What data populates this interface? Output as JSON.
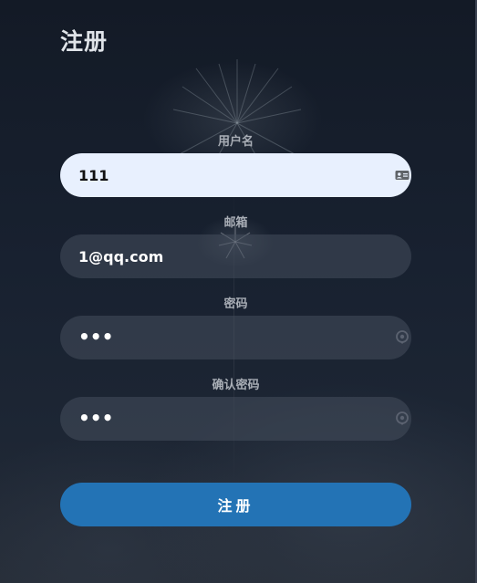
{
  "form": {
    "title": "注册",
    "fields": [
      {
        "label": "用户名",
        "value": "111",
        "icon": "contact-card-icon"
      },
      {
        "label": "邮箱",
        "value": "1@qq.com"
      },
      {
        "label": "密码",
        "value": "•••",
        "icon": "password-reveal-icon"
      },
      {
        "label": "确认密码",
        "value": "•••",
        "icon": "password-reveal-icon"
      }
    ],
    "submit_label": "注册"
  },
  "colors": {
    "button": "#2373b5",
    "autofill_background": "#e8f0fe",
    "background_dark": "#151c28"
  }
}
